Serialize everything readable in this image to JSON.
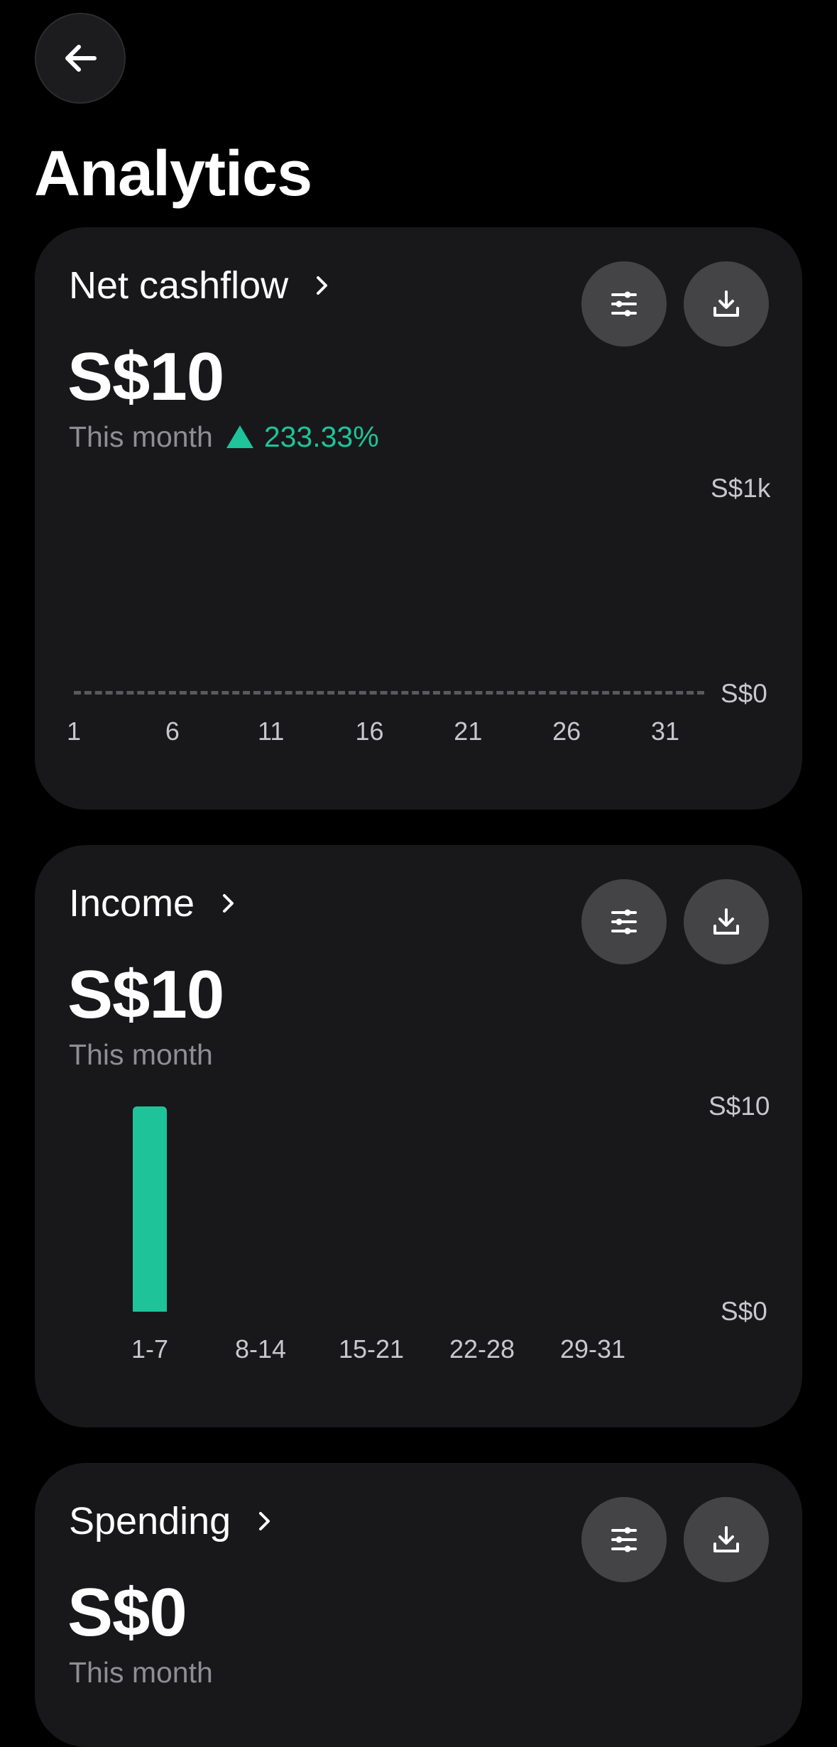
{
  "header": {
    "title": "Analytics"
  },
  "colors": {
    "accent": "#1ec39a",
    "card": "#18181a",
    "button": "#444446"
  },
  "cards": [
    {
      "title": "Net cashflow",
      "amount": "S$10",
      "period": "This month",
      "change": "233.33%",
      "chart_data": {
        "type": "line",
        "x": [
          "1",
          "6",
          "11",
          "16",
          "21",
          "26",
          "31"
        ],
        "y_tick_labels": [
          "S$1k",
          "S$0"
        ],
        "values": []
      }
    },
    {
      "title": "Income",
      "amount": "S$10",
      "period": "This month",
      "chart_data": {
        "type": "bar",
        "categories": [
          "1-7",
          "8-14",
          "15-21",
          "22-28",
          "29-31"
        ],
        "values": [
          10,
          0,
          0,
          0,
          0
        ],
        "ylim": [
          0,
          10
        ],
        "y_tick_labels": [
          "S$10",
          "S$0"
        ]
      }
    },
    {
      "title": "Spending",
      "amount": "S$0",
      "period": "This month"
    }
  ],
  "icons": {
    "back": "arrow-left-icon",
    "chevron": "chevron-right-icon",
    "filter": "sliders-icon",
    "download": "download-icon"
  }
}
